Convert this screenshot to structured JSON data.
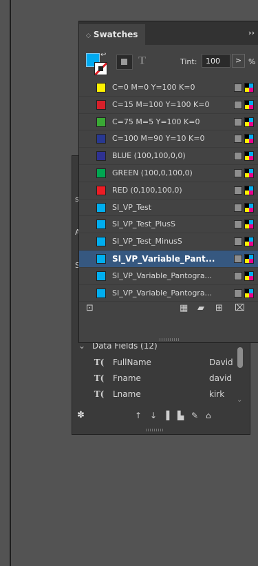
{
  "swatches": {
    "tab_label": "Swatches",
    "more_label": "››",
    "tint_label": "Tint:",
    "tint_value": "100",
    "tint_unit": "%",
    "items": [
      {
        "name": "C=0 M=0 Y=100 K=0",
        "color": "#fff200",
        "selected": false
      },
      {
        "name": "C=15 M=100 Y=100 K=0",
        "color": "#d7202a",
        "selected": false
      },
      {
        "name": "C=75 M=5 Y=100 K=0",
        "color": "#3aa935",
        "selected": false
      },
      {
        "name": "C=100 M=90 Y=10 K=0",
        "color": "#283891",
        "selected": false
      },
      {
        "name": "BLUE (100,100,0,0)",
        "color": "#2e3192",
        "selected": false
      },
      {
        "name": "GREEN (100,0,100,0)",
        "color": "#00a651",
        "selected": false
      },
      {
        "name": "RED (0,100,100,0)",
        "color": "#ed1c24",
        "selected": false
      },
      {
        "name": "SI_VP_Test",
        "color": "#00aeef",
        "selected": false
      },
      {
        "name": "SI_VP_Test_PlusS",
        "color": "#00aeef",
        "selected": false
      },
      {
        "name": "SI_VP_Test_MinusS",
        "color": "#00aeef",
        "selected": false
      },
      {
        "name": "SI_VP_Variable_Pant...",
        "color": "#00aeef",
        "selected": true
      },
      {
        "name": "SI_VP_Variable_Pantogra...",
        "color": "#00aeef",
        "selected": false
      },
      {
        "name": "SI_VP_Variable_Pantogra...",
        "color": "#00aeef",
        "selected": false
      }
    ]
  },
  "data_merge": {
    "section_title": "Data Fields (12)",
    "fields": [
      {
        "name": "FullName",
        "value": "David"
      },
      {
        "name": "Fname",
        "value": "david"
      },
      {
        "name": "Lname",
        "value": "kirk"
      }
    ]
  },
  "colors": {
    "selection": "#365880",
    "panel_bg": "#434343",
    "app_bg": "#535353"
  }
}
